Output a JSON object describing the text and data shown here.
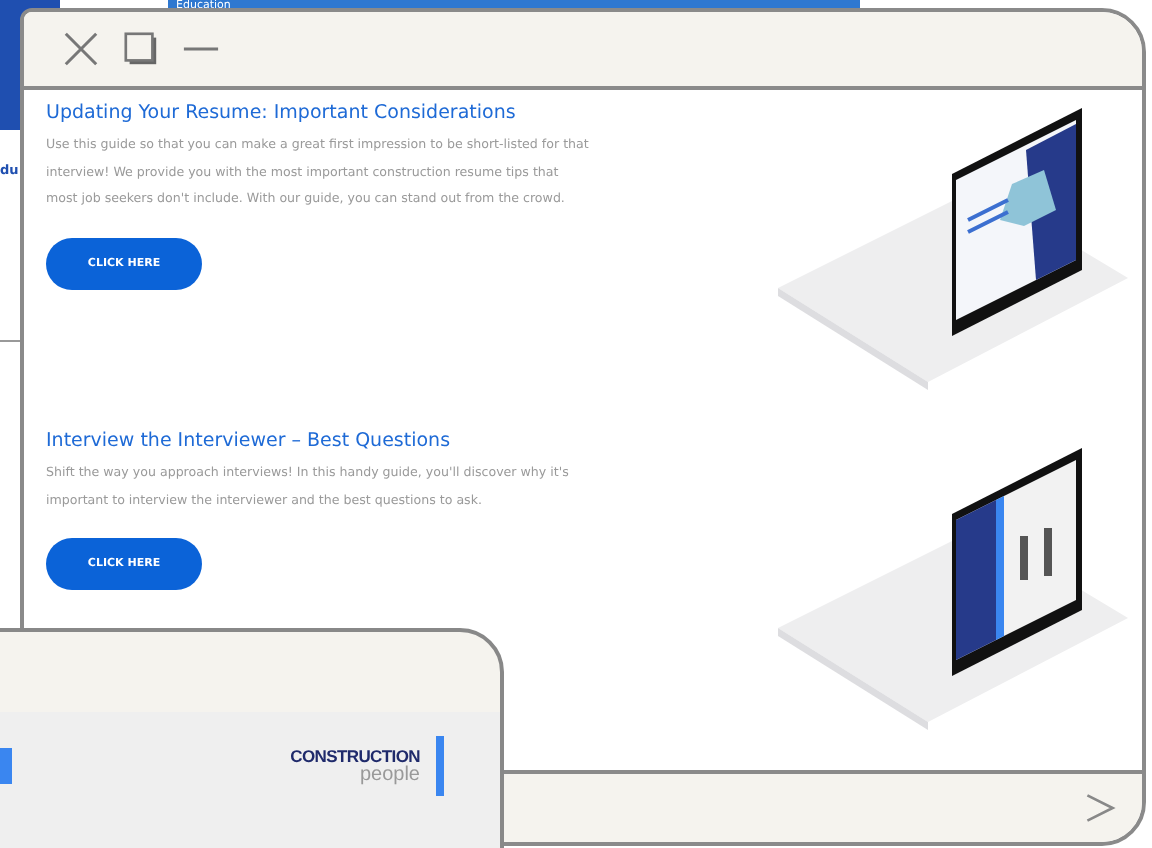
{
  "background_window": {
    "banner_label": "Education",
    "link_text": "du"
  },
  "main_window": {
    "articles": [
      {
        "kind": "hexagon-cover",
        "title": "Updating Your Resume: Important Considerations",
        "body": "Use this guide so that you can make a great first impression to be short-listed for that interview! We provide you with the most important construction resume tips that most job seekers don't include. With our guide, you can stand out from the crowd.",
        "button": "CLICK HERE"
      },
      {
        "kind": "photo-cover",
        "title": "Interview the Interviewer – Best Questions",
        "body": "Shift the way you approach interviews! In this handy guide, you'll discover why it's important to interview the interviewer and the best questions to ask.",
        "button": "CLICK HERE"
      }
    ]
  },
  "lower_window": {
    "logo": {
      "line_1": "CONSTRUCTION",
      "line_2": "people"
    }
  }
}
